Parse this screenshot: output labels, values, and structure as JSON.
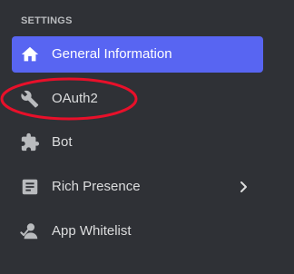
{
  "sidebar": {
    "section_title": "SETTINGS",
    "items": [
      {
        "label": "General Information",
        "icon": "home-icon",
        "active": true
      },
      {
        "label": "OAuth2",
        "icon": "wrench-icon",
        "active": false
      },
      {
        "label": "Bot",
        "icon": "puzzle-icon",
        "active": false
      },
      {
        "label": "Rich Presence",
        "icon": "document-icon",
        "active": false,
        "has_submenu": true
      },
      {
        "label": "App Whitelist",
        "icon": "user-check-icon",
        "active": false
      }
    ]
  },
  "colors": {
    "background": "#2f3136",
    "active": "#5865f2",
    "text": "#dcddde",
    "muted": "#b9bbbe",
    "annotation": "#e8102a"
  }
}
